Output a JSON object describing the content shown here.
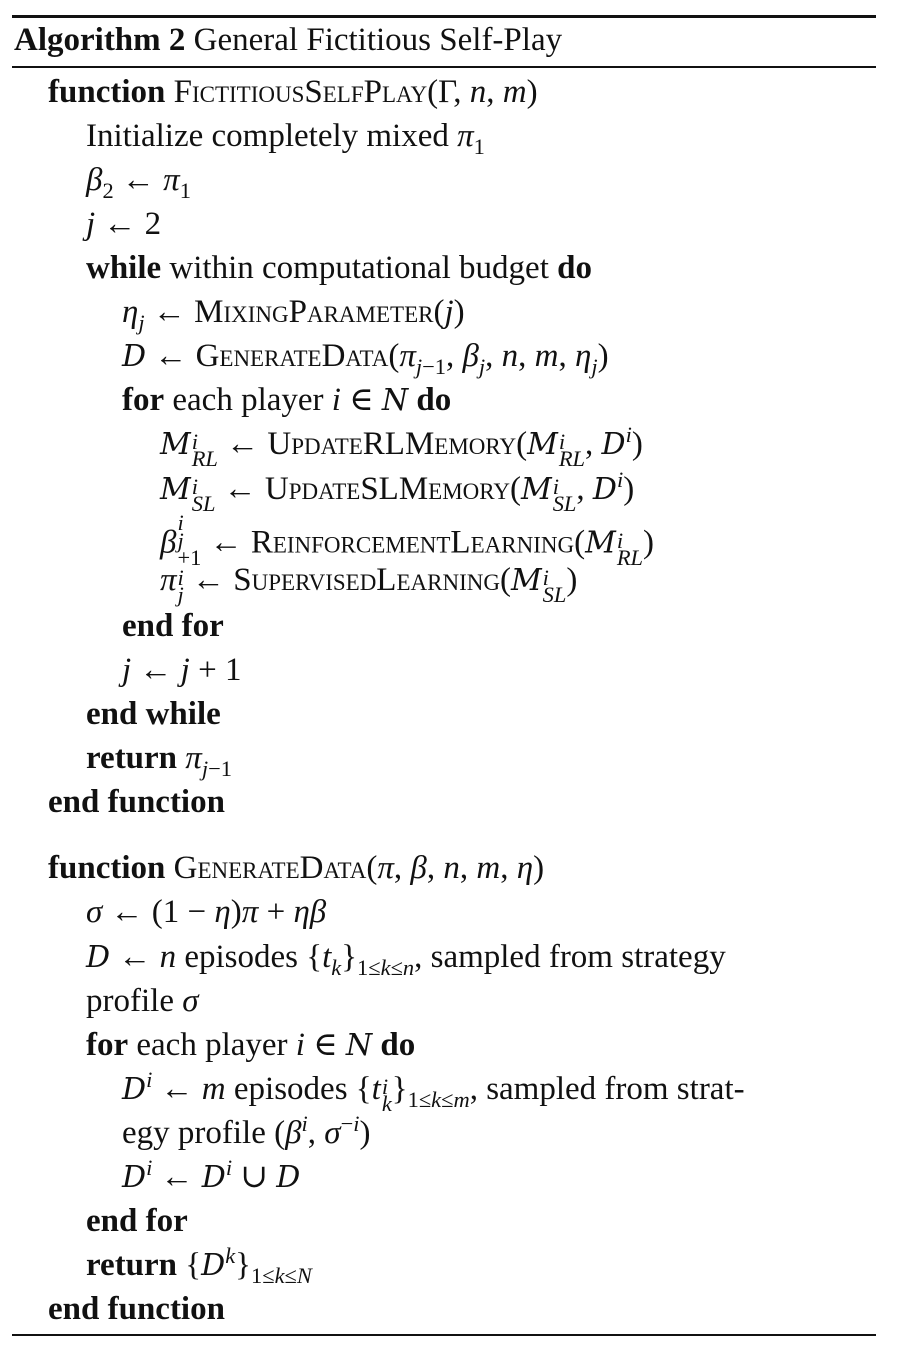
{
  "title": {
    "label": "Algorithm 2",
    "text": "General Fictitious Self-Play"
  },
  "kw": {
    "function": "function",
    "while": "while",
    "do": "do",
    "for": "for",
    "end_for": "end for",
    "end_while": "end while",
    "return": "return",
    "end_function": "end function"
  },
  "lines": {
    "l1_name": "FictitiousSelfPlay",
    "l2": "Initialize completely mixed",
    "l5_text": "within computational budget",
    "l6_fn": "MixingParameter",
    "l7_fn": "GenerateData",
    "l8_text": "each player",
    "l9_fn": "UpdateRLMemory",
    "l10_fn": "UpdateSLMemory",
    "l11_fn": "ReinforcementLearning",
    "l12_fn": "SupervisedLearning",
    "g1_name": "GenerateData",
    "g3_mid": "episodes",
    "g3_tail": ", sampled from strategy",
    "g4": "profile",
    "g5_text": "each player",
    "g6_mid": "episodes",
    "g6_tail": ", sampled from strat-",
    "g7": "egy profile"
  }
}
